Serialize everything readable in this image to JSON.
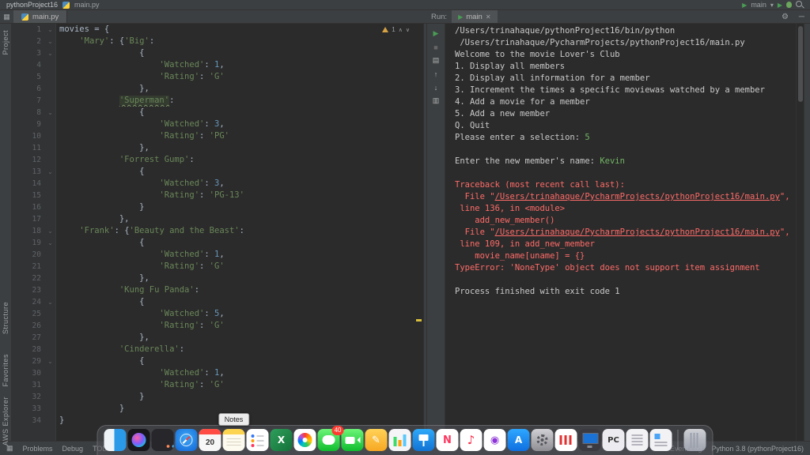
{
  "colors": {
    "string_green": "#6a8759",
    "number_blue": "#6897bb",
    "error_red": "#ff6b68",
    "input_green": "#72b564",
    "run_green": "#499c54",
    "warning_yellow": "#d6a243",
    "panel_bg": "#3c3f41",
    "editor_bg": "#2b2b2b"
  },
  "titlebar": {
    "project": "pythonProject16",
    "file": "main.py",
    "run_config": "main"
  },
  "icons": {
    "play": "▶",
    "caret": "▾",
    "close": "✕",
    "gear": "⚙",
    "hide": "─",
    "fold": "⌄",
    "chev_up": "∧",
    "chev_down": "∨",
    "toolwindow": "▦"
  },
  "editor": {
    "tab": "main.py",
    "warning_count": "1",
    "lines": [
      [
        1,
        1,
        [
          [
            "movies = {",
            "p"
          ]
        ]
      ],
      [
        2,
        1,
        [
          [
            "    ",
            "p"
          ],
          [
            "'Mary'",
            "s"
          ],
          [
            ": {",
            "p"
          ],
          [
            "'Big'",
            "s"
          ],
          [
            ":",
            "p"
          ]
        ]
      ],
      [
        3,
        1,
        [
          [
            "                {",
            "p"
          ]
        ]
      ],
      [
        4,
        0,
        [
          [
            "                    ",
            "p"
          ],
          [
            "'Watched'",
            "s"
          ],
          [
            ": ",
            "p"
          ],
          [
            "1",
            "n"
          ],
          [
            ",",
            "p"
          ]
        ]
      ],
      [
        5,
        0,
        [
          [
            "                    ",
            "p"
          ],
          [
            "'Rating'",
            "s"
          ],
          [
            ": ",
            "p"
          ],
          [
            "'G'",
            "s"
          ]
        ]
      ],
      [
        6,
        0,
        [
          [
            "                },",
            "p"
          ]
        ]
      ],
      [
        7,
        0,
        [
          [
            "            ",
            "p"
          ],
          [
            "'Superman'",
            "hl"
          ],
          [
            ":",
            "p"
          ]
        ]
      ],
      [
        8,
        1,
        [
          [
            "                {",
            "p"
          ]
        ]
      ],
      [
        9,
        0,
        [
          [
            "                    ",
            "p"
          ],
          [
            "'Watched'",
            "s"
          ],
          [
            ": ",
            "p"
          ],
          [
            "3",
            "n"
          ],
          [
            ",",
            "p"
          ]
        ]
      ],
      [
        10,
        0,
        [
          [
            "                    ",
            "p"
          ],
          [
            "'Rating'",
            "s"
          ],
          [
            ": ",
            "p"
          ],
          [
            "'PG'",
            "s"
          ]
        ]
      ],
      [
        11,
        0,
        [
          [
            "                },",
            "p"
          ]
        ]
      ],
      [
        12,
        0,
        [
          [
            "            ",
            "p"
          ],
          [
            "'Forrest Gump'",
            "s"
          ],
          [
            ":",
            "p"
          ]
        ]
      ],
      [
        13,
        1,
        [
          [
            "                {",
            "p"
          ]
        ]
      ],
      [
        14,
        0,
        [
          [
            "                    ",
            "p"
          ],
          [
            "'Watched'",
            "s"
          ],
          [
            ": ",
            "p"
          ],
          [
            "3",
            "n"
          ],
          [
            ",",
            "p"
          ]
        ]
      ],
      [
        15,
        0,
        [
          [
            "                    ",
            "p"
          ],
          [
            "'Rating'",
            "s"
          ],
          [
            ": ",
            "p"
          ],
          [
            "'PG-13'",
            "s"
          ]
        ]
      ],
      [
        16,
        0,
        [
          [
            "                }",
            "p"
          ]
        ]
      ],
      [
        17,
        0,
        [
          [
            "            },",
            "p"
          ]
        ]
      ],
      [
        18,
        1,
        [
          [
            "    ",
            "p"
          ],
          [
            "'Frank'",
            "s"
          ],
          [
            ": {",
            "p"
          ],
          [
            "'Beauty and the Beast'",
            "s"
          ],
          [
            ":",
            "p"
          ]
        ]
      ],
      [
        19,
        1,
        [
          [
            "                {",
            "p"
          ]
        ]
      ],
      [
        20,
        0,
        [
          [
            "                    ",
            "p"
          ],
          [
            "'Watched'",
            "s"
          ],
          [
            ": ",
            "p"
          ],
          [
            "1",
            "n"
          ],
          [
            ",",
            "p"
          ]
        ]
      ],
      [
        21,
        0,
        [
          [
            "                    ",
            "p"
          ],
          [
            "'Rating'",
            "s"
          ],
          [
            ": ",
            "p"
          ],
          [
            "'G'",
            "s"
          ]
        ]
      ],
      [
        22,
        0,
        [
          [
            "                },",
            "p"
          ]
        ]
      ],
      [
        23,
        0,
        [
          [
            "            ",
            "p"
          ],
          [
            "'Kung Fu Panda'",
            "s"
          ],
          [
            ":",
            "p"
          ]
        ]
      ],
      [
        24,
        1,
        [
          [
            "                {",
            "p"
          ]
        ]
      ],
      [
        25,
        0,
        [
          [
            "                    ",
            "p"
          ],
          [
            "'Watched'",
            "s"
          ],
          [
            ": ",
            "p"
          ],
          [
            "5",
            "n"
          ],
          [
            ",",
            "p"
          ]
        ]
      ],
      [
        26,
        0,
        [
          [
            "                    ",
            "p"
          ],
          [
            "'Rating'",
            "s"
          ],
          [
            ": ",
            "p"
          ],
          [
            "'G'",
            "s"
          ]
        ]
      ],
      [
        27,
        0,
        [
          [
            "                },",
            "p"
          ]
        ]
      ],
      [
        28,
        0,
        [
          [
            "            ",
            "p"
          ],
          [
            "'Cinderella'",
            "s"
          ],
          [
            ":",
            "p"
          ]
        ]
      ],
      [
        29,
        1,
        [
          [
            "                {",
            "p"
          ]
        ]
      ],
      [
        30,
        0,
        [
          [
            "                    ",
            "p"
          ],
          [
            "'Watched'",
            "s"
          ],
          [
            ": ",
            "p"
          ],
          [
            "1",
            "n"
          ],
          [
            ",",
            "p"
          ]
        ]
      ],
      [
        31,
        0,
        [
          [
            "                    ",
            "p"
          ],
          [
            "'Rating'",
            "s"
          ],
          [
            ": ",
            "p"
          ],
          [
            "'G'",
            "s"
          ]
        ]
      ],
      [
        32,
        0,
        [
          [
            "                }",
            "p"
          ]
        ]
      ],
      [
        33,
        0,
        [
          [
            "            }",
            "p"
          ]
        ]
      ],
      [
        34,
        0,
        [
          [
            "}",
            "p"
          ]
        ]
      ]
    ]
  },
  "run_panel": {
    "label": "Run:",
    "tab": "main",
    "toolbar": [
      {
        "name": "rerun-icon",
        "glyph": "▶",
        "cls": "rt-green"
      },
      {
        "name": "stop-icon",
        "glyph": "■",
        "cls": "rt-dim"
      },
      {
        "name": "restore-layout-icon",
        "glyph": "▤",
        "cls": ""
      },
      {
        "name": "up-stack-trace-icon",
        "glyph": "↑",
        "cls": ""
      },
      {
        "name": "down-stack-trace-icon",
        "glyph": "↓",
        "cls": ""
      },
      {
        "name": "clear-console-icon",
        "glyph": "▥",
        "cls": ""
      }
    ]
  },
  "console": {
    "lines": [
      [
        [
          "/Users/trinahaque/pythonProject16/bin/python",
          "o"
        ]
      ],
      [
        [
          " /Users/trinahaque/PycharmProjects/pythonProject16/main.py",
          "o"
        ]
      ],
      [
        [
          "Welcome to the movie Lover's Club",
          "o"
        ]
      ],
      [
        [
          "1. Display all members",
          "o"
        ]
      ],
      [
        [
          "2. Display all information for a member",
          "o"
        ]
      ],
      [
        [
          "3. Increment the times a specific moviewas watched by a member",
          "o"
        ]
      ],
      [
        [
          "4. Add a movie for a member",
          "o"
        ]
      ],
      [
        [
          "5. Add a new member",
          "o"
        ]
      ],
      [
        [
          "Q. Quit",
          "o"
        ]
      ],
      [
        [
          "Please enter a selection: ",
          "o"
        ],
        [
          "5",
          "g"
        ]
      ],
      [],
      [
        [
          "Enter the new member's name: ",
          "o"
        ],
        [
          "Kevin",
          "g"
        ]
      ],
      [],
      [
        [
          "Traceback (most recent call last):",
          "e"
        ]
      ],
      [
        [
          "  File \"",
          "e"
        ],
        [
          "/Users/trinahaque/PycharmProjects/pythonProject16/main.py",
          "el"
        ],
        [
          "\",",
          "e"
        ]
      ],
      [
        [
          " line 136, in <module>",
          "e"
        ]
      ],
      [
        [
          "    add_new_member()",
          "e"
        ]
      ],
      [
        [
          "  File \"",
          "e"
        ],
        [
          "/Users/trinahaque/PycharmProjects/pythonProject16/main.py",
          "el"
        ],
        [
          "\",",
          "e"
        ]
      ],
      [
        [
          " line 109, in add_new_member",
          "e"
        ]
      ],
      [
        [
          "    movie_name[uname] = {}",
          "e"
        ]
      ],
      [
        [
          "TypeError: 'NoneType' object does not support item assignment",
          "e"
        ]
      ],
      [],
      [
        [
          "Process finished with exit code 1",
          "o"
        ]
      ]
    ]
  },
  "left_strip": [
    "Project",
    "Structure",
    "Favorites",
    "AWS Explorer"
  ],
  "statusbar": {
    "left": [
      "Problems",
      "Debug",
      "TODO"
    ],
    "right": [
      "Event Log",
      "Python 3.8 (pythonProject16)"
    ]
  },
  "dock": {
    "tooltip": "Notes",
    "calendar_day": "20",
    "items": [
      {
        "id": "finder"
      },
      {
        "id": "siri"
      },
      {
        "id": "launchpad"
      },
      {
        "id": "safari"
      },
      {
        "id": "calendar"
      },
      {
        "id": "notes"
      },
      {
        "id": "reminders"
      },
      {
        "id": "excel",
        "glyph": "X"
      },
      {
        "id": "photos"
      },
      {
        "id": "messages",
        "badge": "40"
      },
      {
        "id": "facetime"
      },
      {
        "id": "pages",
        "glyph": "✎"
      },
      {
        "id": "numbers"
      },
      {
        "id": "keynote"
      },
      {
        "id": "news",
        "glyph": "N"
      },
      {
        "id": "music",
        "glyph": "♪"
      },
      {
        "id": "podcasts",
        "glyph": "◉"
      },
      {
        "id": "appstore",
        "glyph": "A"
      },
      {
        "id": "settings"
      },
      {
        "id": "parallels"
      },
      {
        "id": "windows"
      },
      {
        "id": "pc",
        "glyph": "PC"
      },
      {
        "id": "preview"
      },
      {
        "id": "textedit"
      },
      {
        "id": "trash",
        "sep": true
      }
    ]
  }
}
